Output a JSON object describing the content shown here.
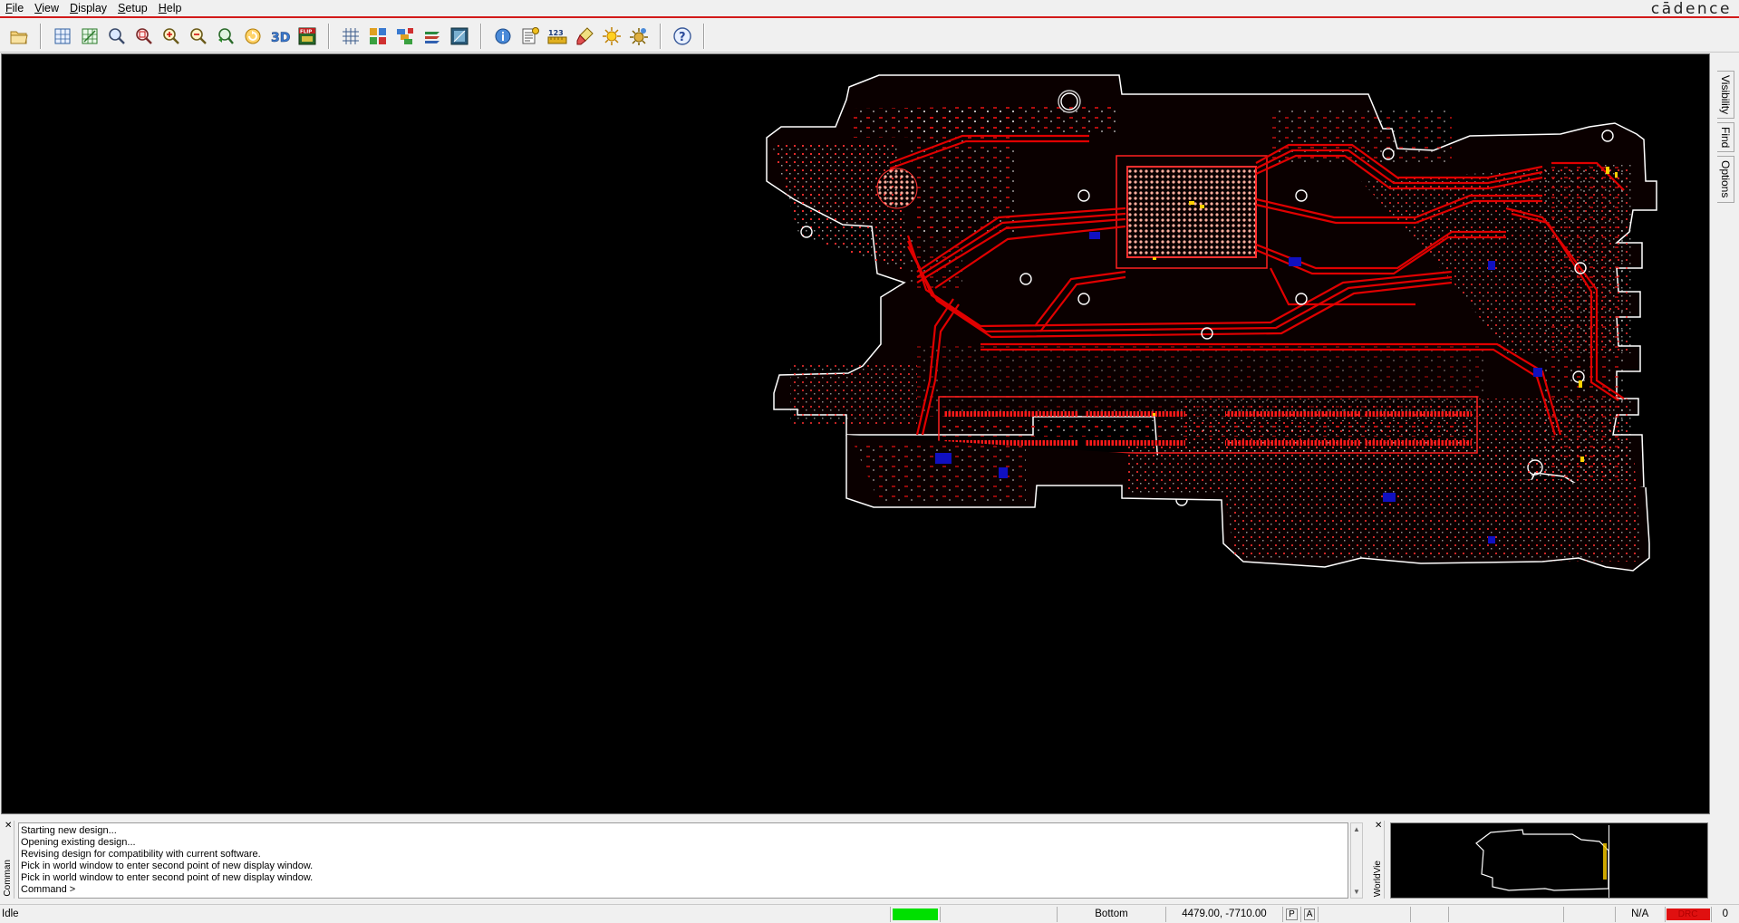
{
  "brand": "cādence",
  "menu": [
    {
      "label": "File",
      "mnemonic": "F",
      "rest": "ile"
    },
    {
      "label": "View",
      "mnemonic": "V",
      "rest": "iew"
    },
    {
      "label": "Display",
      "mnemonic": "D",
      "rest": "isplay"
    },
    {
      "label": "Setup",
      "mnemonic": "S",
      "rest": "etup"
    },
    {
      "label": "Help",
      "mnemonic": "H",
      "rest": "elp"
    }
  ],
  "toolbar": {
    "groups": [
      [
        "open-folder-icon"
      ],
      [
        "zoom-fit-icon",
        "zoom-world-icon",
        "zoom-window-icon",
        "zoom-points-icon",
        "zoom-in-icon",
        "zoom-out-icon",
        "zoom-previous-icon",
        "redraw-icon",
        "view-3d-icon",
        "flip-design-icon"
      ],
      [
        "grid-icon",
        "color-icon",
        "layer-priority-icon",
        "highlight-icon",
        "shadow-mode-icon"
      ],
      [
        "info-icon",
        "report-icon",
        "measure-icon",
        "clear-highlight-icon",
        "brightness-icon",
        "dim-icon"
      ],
      [
        "help-icon"
      ]
    ],
    "labels": {
      "view3d": "3D",
      "flip": "FLIP",
      "measure": "123"
    }
  },
  "side_tabs": [
    "Visibility",
    "Find",
    "Options"
  ],
  "command_panel": {
    "strip_label": "Comman",
    "log": [
      "Starting new design...",
      "Opening existing design...",
      "Revising design for compatibility with current software.",
      "Pick in world window to enter second point of new display window.",
      "Pick in world window to enter second point of new display window.",
      "Command >"
    ]
  },
  "worldview_panel": {
    "strip_label": "WorldVie"
  },
  "status": {
    "state": "Idle",
    "layer": "Bottom",
    "coordinates": "4479.00, -7710.00",
    "p_button": "P",
    "a_button": "A",
    "na": "N/A",
    "drc": "DRC",
    "drc_count": "0"
  },
  "colors": {
    "canvas": "#000000",
    "trace": "#e00000",
    "accent_red": "#d21a1a",
    "busy_green": "#00e000",
    "drc_red": "#e01010"
  }
}
